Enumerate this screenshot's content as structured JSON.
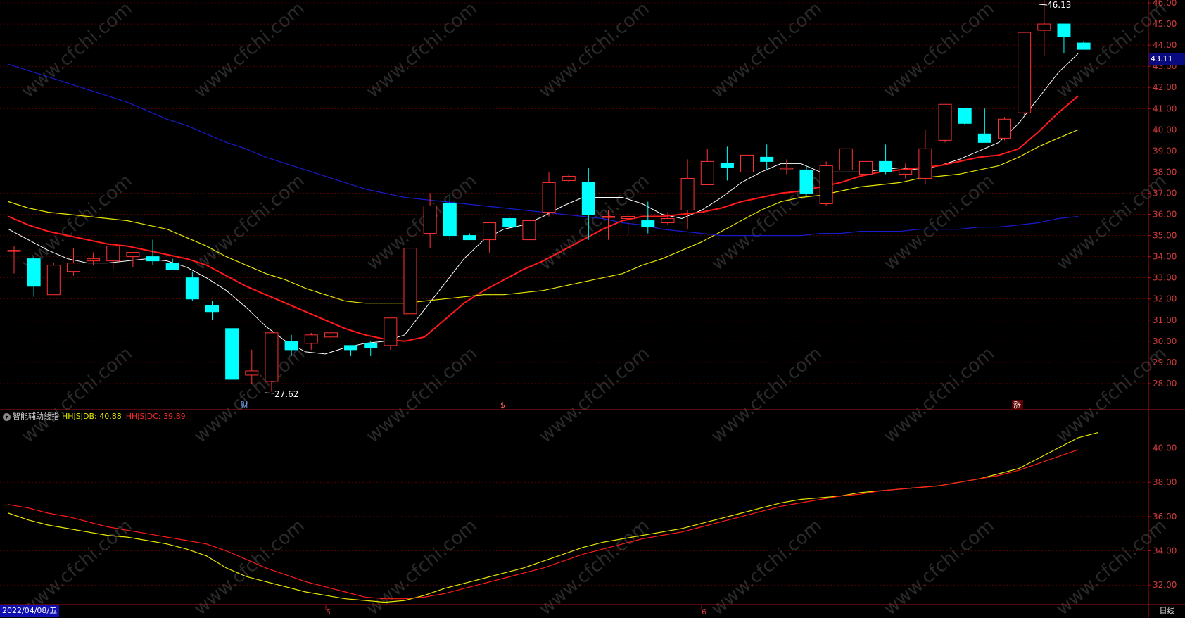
{
  "indicator": {
    "name": "智能辅助线指",
    "db_label": "HHJSJDB: 40.88",
    "dc_label": "HHJSJDC: 39.89"
  },
  "footer": {
    "date": "2022/04/08/五",
    "period": "日线",
    "month_labels": [
      "5",
      "6"
    ]
  },
  "markers": {
    "high_label": "46.13",
    "low_label": "27.62",
    "current_price": "43.11",
    "event_labels": [
      "财",
      "$",
      "涨"
    ]
  },
  "watermark": "www.cfchi.com",
  "colors": {
    "up": "#ff3232",
    "down": "#00ffff",
    "ma5": "#ffffff",
    "ma10": "#ff1a1a",
    "ma20": "#e6e600",
    "ma60": "#1a1acc",
    "grid": "#8b0000"
  },
  "chart_data": [
    {
      "type": "candlestick",
      "title": "",
      "ylim": [
        27.0,
        46.0
      ],
      "yticks": [
        28,
        29,
        30,
        31,
        32,
        33,
        34,
        35,
        36,
        37,
        38,
        39,
        40,
        41,
        42,
        43,
        44,
        45,
        46
      ],
      "ytick_labels": [
        "28.00",
        "29.00",
        "30.00",
        "31.00",
        "32.00",
        "33.00",
        "34.00",
        "35.00",
        "36.00",
        "37.00",
        "38.00",
        "39.00",
        "40.00",
        "41.00",
        "42.00",
        "43.00",
        "44.00",
        "45.00",
        "46.00"
      ],
      "candles": [
        {
          "o": 34.25,
          "h": 34.5,
          "l": 33.2,
          "c": 34.3
        },
        {
          "o": 33.9,
          "h": 34.0,
          "l": 32.1,
          "c": 32.6
        },
        {
          "o": 32.2,
          "h": 33.7,
          "l": 32.2,
          "c": 33.6
        },
        {
          "o": 33.3,
          "h": 34.4,
          "l": 33.1,
          "c": 33.7
        },
        {
          "o": 33.8,
          "h": 34.2,
          "l": 33.6,
          "c": 33.9
        },
        {
          "o": 33.8,
          "h": 34.4,
          "l": 33.4,
          "c": 34.5
        },
        {
          "o": 34.0,
          "h": 34.2,
          "l": 33.5,
          "c": 34.2
        },
        {
          "o": 34.0,
          "h": 34.8,
          "l": 33.6,
          "c": 33.8
        },
        {
          "o": 33.7,
          "h": 33.9,
          "l": 33.4,
          "c": 33.4
        },
        {
          "o": 33.0,
          "h": 33.3,
          "l": 31.9,
          "c": 32.0
        },
        {
          "o": 31.7,
          "h": 31.9,
          "l": 31.0,
          "c": 31.4
        },
        {
          "o": 30.6,
          "h": 30.6,
          "l": 28.2,
          "c": 28.2
        },
        {
          "o": 28.4,
          "h": 29.6,
          "l": 28.0,
          "c": 28.6
        },
        {
          "o": 28.1,
          "h": 30.3,
          "l": 27.62,
          "c": 30.4
        },
        {
          "o": 30.0,
          "h": 30.3,
          "l": 29.3,
          "c": 29.6
        },
        {
          "o": 29.9,
          "h": 30.4,
          "l": 29.6,
          "c": 30.3
        },
        {
          "o": 30.2,
          "h": 30.6,
          "l": 29.9,
          "c": 30.4
        },
        {
          "o": 29.8,
          "h": 29.8,
          "l": 29.3,
          "c": 29.6
        },
        {
          "o": 29.9,
          "h": 30.0,
          "l": 29.3,
          "c": 29.7
        },
        {
          "o": 29.8,
          "h": 31.1,
          "l": 29.6,
          "c": 31.1
        },
        {
          "o": 31.3,
          "h": 31.4,
          "l": 32.5,
          "c": 34.4
        },
        {
          "o": 35.1,
          "h": 37.0,
          "l": 34.4,
          "c": 36.4
        },
        {
          "o": 36.5,
          "h": 37.0,
          "l": 34.8,
          "c": 35.0
        },
        {
          "o": 35.0,
          "h": 35.1,
          "l": 34.8,
          "c": 34.8
        },
        {
          "o": 34.8,
          "h": 35.6,
          "l": 34.2,
          "c": 35.6
        },
        {
          "o": 35.8,
          "h": 35.9,
          "l": 35.4,
          "c": 35.4
        },
        {
          "o": 34.8,
          "h": 35.7,
          "l": 34.8,
          "c": 35.7
        },
        {
          "o": 36.1,
          "h": 38.0,
          "l": 35.9,
          "c": 37.5
        },
        {
          "o": 37.6,
          "h": 37.9,
          "l": 37.5,
          "c": 37.8
        },
        {
          "o": 37.5,
          "h": 38.2,
          "l": 34.8,
          "c": 36.0
        },
        {
          "o": 35.9,
          "h": 36.2,
          "l": 34.8,
          "c": 35.9
        },
        {
          "o": 35.8,
          "h": 36.1,
          "l": 35.0,
          "c": 35.9
        },
        {
          "o": 35.7,
          "h": 36.6,
          "l": 35.1,
          "c": 35.4
        },
        {
          "o": 35.6,
          "h": 36.1,
          "l": 35.5,
          "c": 35.8
        },
        {
          "o": 36.2,
          "h": 38.6,
          "l": 35.3,
          "c": 37.7
        },
        {
          "o": 37.4,
          "h": 39.1,
          "l": 37.4,
          "c": 38.5
        },
        {
          "o": 38.4,
          "h": 39.2,
          "l": 37.6,
          "c": 38.2
        },
        {
          "o": 38.0,
          "h": 38.7,
          "l": 37.8,
          "c": 38.8
        },
        {
          "o": 38.7,
          "h": 39.3,
          "l": 38.1,
          "c": 38.5
        },
        {
          "o": 38.2,
          "h": 38.6,
          "l": 37.9,
          "c": 38.2
        },
        {
          "o": 38.1,
          "h": 38.3,
          "l": 36.9,
          "c": 37.0
        },
        {
          "o": 36.5,
          "h": 38.5,
          "l": 36.4,
          "c": 38.3
        },
        {
          "o": 38.1,
          "h": 39.1,
          "l": 38.1,
          "c": 39.1
        },
        {
          "o": 37.9,
          "h": 38.6,
          "l": 37.2,
          "c": 38.5
        },
        {
          "o": 38.5,
          "h": 39.3,
          "l": 37.9,
          "c": 38.0
        },
        {
          "o": 37.9,
          "h": 38.4,
          "l": 37.7,
          "c": 38.1
        },
        {
          "o": 37.7,
          "h": 40.0,
          "l": 37.4,
          "c": 39.1
        },
        {
          "o": 39.5,
          "h": 41.2,
          "l": 39.4,
          "c": 41.2
        },
        {
          "o": 41.0,
          "h": 41.0,
          "l": 40.2,
          "c": 40.3
        },
        {
          "o": 39.8,
          "h": 41.0,
          "l": 39.5,
          "c": 39.4
        },
        {
          "o": 39.6,
          "h": 40.6,
          "l": 39.5,
          "c": 40.5
        },
        {
          "o": 40.8,
          "h": 44.6,
          "l": 40.7,
          "c": 44.6
        },
        {
          "o": 44.7,
          "h": 46.13,
          "l": 43.5,
          "c": 45.0
        },
        {
          "o": 45.0,
          "h": 45.0,
          "l": 43.6,
          "c": 44.4
        },
        {
          "o": 44.1,
          "h": 44.2,
          "l": 43.8,
          "c": 43.8
        }
      ],
      "series": [
        {
          "name": "",
          "color": "#ffffff",
          "values": [
            35.3,
            34.8,
            34.3,
            33.9,
            33.7,
            33.7,
            33.8,
            33.9,
            33.8,
            33.5,
            33.0,
            32.4,
            31.6,
            30.7,
            30.0,
            29.5,
            29.4,
            29.7,
            29.9,
            30.0,
            30.3,
            31.5,
            32.7,
            33.9,
            34.8,
            35.3,
            35.5,
            35.9,
            36.4,
            36.8,
            36.8,
            36.8,
            36.5,
            36.0,
            35.8,
            36.2,
            36.8,
            37.5,
            38.0,
            38.4,
            38.4,
            38.0,
            38.0,
            38.0,
            38.1,
            38.2,
            38.1,
            38.3,
            38.6,
            39.0,
            39.4,
            40.3,
            41.5,
            42.7,
            43.6
          ]
        },
        {
          "name": "",
          "color": "#ff1a1a",
          "values": [
            35.9,
            35.5,
            35.2,
            35.0,
            34.8,
            34.6,
            34.5,
            34.3,
            34.1,
            33.9,
            33.6,
            33.1,
            32.6,
            32.2,
            31.8,
            31.4,
            31.0,
            30.6,
            30.3,
            30.1,
            30.0,
            30.2,
            31.0,
            31.8,
            32.4,
            32.9,
            33.4,
            33.8,
            34.3,
            34.8,
            35.3,
            35.7,
            35.9,
            35.9,
            36.0,
            36.1,
            36.3,
            36.6,
            36.8,
            37.0,
            37.1,
            37.3,
            37.5,
            37.8,
            38.0,
            38.1,
            38.2,
            38.3,
            38.5,
            38.7,
            38.8,
            39.1,
            39.9,
            40.8,
            41.6
          ]
        },
        {
          "name": "",
          "color": "#e6e600",
          "values": [
            36.6,
            36.3,
            36.1,
            36.0,
            35.9,
            35.8,
            35.7,
            35.5,
            35.3,
            34.9,
            34.5,
            34.0,
            33.6,
            33.2,
            32.9,
            32.5,
            32.2,
            31.9,
            31.8,
            31.8,
            31.8,
            31.9,
            32.0,
            32.1,
            32.2,
            32.2,
            32.3,
            32.4,
            32.6,
            32.8,
            33.0,
            33.2,
            33.6,
            33.9,
            34.3,
            34.7,
            35.2,
            35.7,
            36.2,
            36.6,
            36.8,
            36.9,
            37.1,
            37.3,
            37.4,
            37.5,
            37.7,
            37.8,
            37.9,
            38.1,
            38.3,
            38.7,
            39.2,
            39.6,
            40.0
          ]
        },
        {
          "name": "",
          "color": "#1a1acc",
          "values": [
            43.1,
            42.8,
            42.5,
            42.2,
            41.9,
            41.6,
            41.3,
            40.9,
            40.5,
            40.2,
            39.8,
            39.4,
            39.1,
            38.7,
            38.4,
            38.1,
            37.8,
            37.5,
            37.2,
            37.0,
            36.8,
            36.7,
            36.6,
            36.5,
            36.4,
            36.3,
            36.2,
            36.1,
            36.0,
            35.9,
            35.8,
            35.6,
            35.5,
            35.3,
            35.2,
            35.1,
            35.0,
            35.0,
            35.0,
            35.0,
            35.0,
            35.1,
            35.1,
            35.2,
            35.2,
            35.2,
            35.3,
            35.3,
            35.3,
            35.4,
            35.4,
            35.5,
            35.6,
            35.8,
            35.9
          ]
        }
      ]
    },
    {
      "type": "line",
      "title": "",
      "ylim": [
        30.9,
        41.5
      ],
      "yticks": [
        32,
        34,
        36,
        38,
        40
      ],
      "ytick_labels": [
        "32.00",
        "34.00",
        "36.00",
        "38.00",
        "40.00"
      ],
      "series": [
        {
          "name": "HHJSJDB",
          "color": "#e6e600",
          "values": [
            36.2,
            35.8,
            35.5,
            35.3,
            35.1,
            34.9,
            34.8,
            34.6,
            34.4,
            34.1,
            33.7,
            33.0,
            32.5,
            32.2,
            31.9,
            31.6,
            31.4,
            31.2,
            31.1,
            31.0,
            31.1,
            31.4,
            31.8,
            32.1,
            32.4,
            32.7,
            33.0,
            33.4,
            33.8,
            34.2,
            34.5,
            34.7,
            34.9,
            35.1,
            35.3,
            35.6,
            35.9,
            36.2,
            36.5,
            36.8,
            37.0,
            37.1,
            37.2,
            37.4,
            37.5,
            37.6,
            37.7,
            37.8,
            38.0,
            38.2,
            38.5,
            38.8,
            39.4,
            40.0,
            40.6,
            40.9
          ]
        },
        {
          "name": "HHJSJDC",
          "color": "#ff1a1a",
          "values": [
            36.7,
            36.5,
            36.2,
            36.0,
            35.7,
            35.4,
            35.2,
            35.0,
            34.8,
            34.6,
            34.4,
            34.0,
            33.5,
            33.0,
            32.6,
            32.2,
            31.9,
            31.6,
            31.3,
            31.2,
            31.2,
            31.3,
            31.5,
            31.8,
            32.1,
            32.4,
            32.7,
            33.0,
            33.4,
            33.8,
            34.1,
            34.4,
            34.7,
            34.9,
            35.1,
            35.4,
            35.7,
            36.0,
            36.3,
            36.6,
            36.8,
            37.0,
            37.2,
            37.3,
            37.5,
            37.6,
            37.7,
            37.8,
            38.0,
            38.2,
            38.4,
            38.7,
            39.1,
            39.5,
            39.9
          ]
        }
      ]
    }
  ]
}
